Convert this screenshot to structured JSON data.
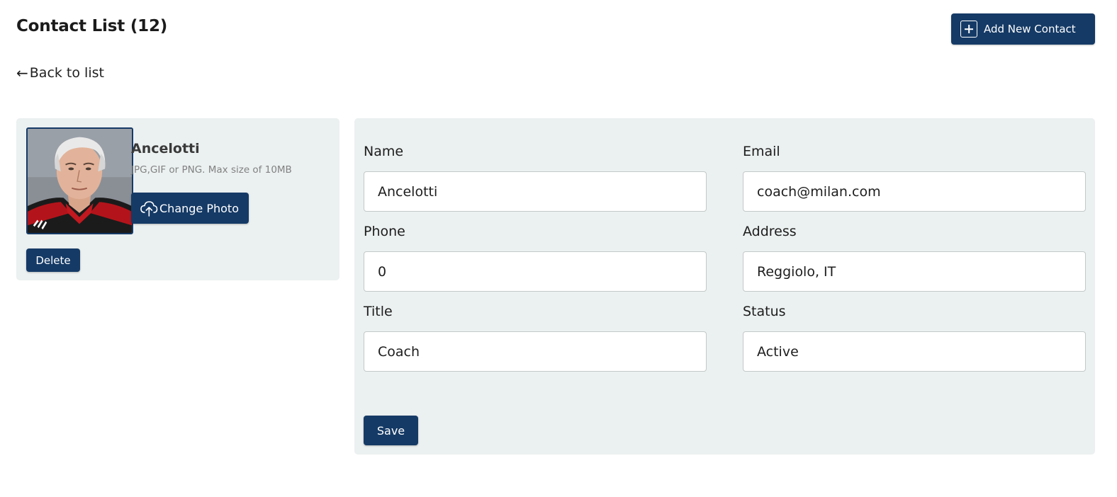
{
  "header": {
    "title": "Contact List (12)",
    "add_button_label": "Add New Contact",
    "add_icon": "plus-square-icon"
  },
  "nav": {
    "back_label": "Back to list",
    "back_icon": "arrow-left-icon"
  },
  "profile": {
    "name": "Ancelotti",
    "photo_hint": "JPG,GIF or PNG. Max size of 10MB",
    "change_photo_label": "Change Photo",
    "change_photo_icon": "cloud-upload-icon",
    "delete_label": "Delete"
  },
  "form": {
    "name_label": "Name",
    "name_value": "Ancelotti",
    "email_label": "Email",
    "email_value": "coach@milan.com",
    "phone_label": "Phone",
    "phone_value": "0",
    "address_label": "Address",
    "address_value": "Reggiolo, IT",
    "title_label": "Title",
    "title_value": "Coach",
    "status_label": "Status",
    "status_value": "Active",
    "save_label": "Save"
  },
  "colors": {
    "primary": "#153a66",
    "card_background": "#ebf0f0",
    "input_border": "#c3c8c8"
  }
}
